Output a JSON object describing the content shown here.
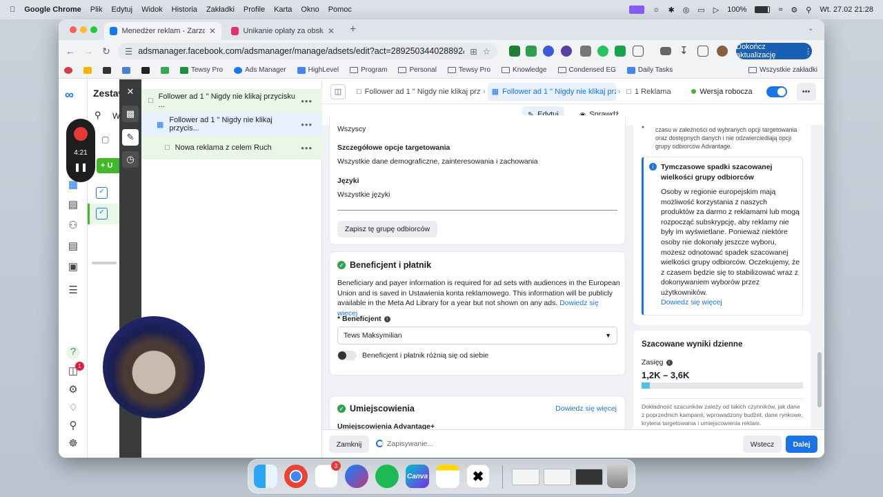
{
  "macbar": {
    "app": "Google Chrome",
    "menus": [
      "Plik",
      "Edytuj",
      "Widok",
      "Historia",
      "Zakładki",
      "Profile",
      "Karta",
      "Okno",
      "Pomoc"
    ],
    "battery": "100%",
    "datetime": "Wt. 27.02  21:28"
  },
  "browser": {
    "tabs": [
      {
        "title": "Menedżer reklam - Zarządza",
        "active": true,
        "favicon_color": "#1877f2"
      },
      {
        "title": "Unikanie opłaty za obsługę r",
        "active": false,
        "favicon_color": "#e1306c"
      }
    ],
    "url": "adsmanager.facebook.com/adsmanager/manage/adsets/edit?act=289250344028892&busines...",
    "update_label": "Dokończ aktualizację",
    "bookmarks": [
      "Tewsy Pro",
      "Ads Manager",
      "HighLevel",
      "Program",
      "Personal",
      "Tewsy Pro",
      "Knowledge",
      "Condensed EG",
      "Daily Tasks"
    ],
    "all_bookmarks": "Wszystkie zakładki"
  },
  "rail": {
    "title_partial": "Zestaw",
    "search_partial": "W",
    "notification_count": "1",
    "create_partial": "U"
  },
  "recorder": {
    "time": "4:21"
  },
  "tree": {
    "items": [
      {
        "label": "Follower ad 1 \" Nigdy nie klikaj przycisku ...",
        "level": 0
      },
      {
        "label": "Follower ad 1 \" Nigdy nie klikaj przycis...",
        "level": 1
      },
      {
        "label": "Nowa reklama z celem Ruch",
        "level": 2
      }
    ]
  },
  "breadcrumbs": {
    "campaign": "Follower ad 1 \" Nigdy nie klikaj przyc",
    "adset": "Follower ad 1 \" Nigdy nie klikaj przyc",
    "ad": "1 Reklama",
    "status": "Wersja robocza"
  },
  "modes": {
    "edit": "Edytuj",
    "review": "Sprawdź"
  },
  "audience": {
    "top_value": "Wszyscy",
    "detailed_label": "Szczegółowe opcje targetowania",
    "detailed_value": "Wszystkie dane demograficzne, zainteresowania i zachowania",
    "languages_label": "Języki",
    "languages_value": "Wszystkie języki",
    "save_button": "Zapisz tę grupę odbiorców"
  },
  "beneficiary": {
    "title": "Beneficjent i płatnik",
    "description": "Beneficiary and payer information is required for ad sets with audiences in the European Union and is saved in Ustawienia konta reklamowego. This information will be publicly available in the Meta Ad Library for a year but not shown on any ads.",
    "learn_more": "Dowiedz się więcej",
    "field_label": "* Beneficjent",
    "field_value": "Tews Maksymilian",
    "toggle_label": "Beneficjent i płatnik różnią się od siebie"
  },
  "placements": {
    "title": "Umiejscowienia",
    "learn_more": "Dowiedz się więcej",
    "sub_partial": "Umiejscowienia Advantage+"
  },
  "bottom": {
    "close": "Zamknij",
    "saving": "Zapisywanie...",
    "back": "Wstecz",
    "next": "Dalej"
  },
  "sidebar": {
    "top_note": "czasu w zależności od wybranych opcji targetowania oraz dostępnych danych i nie odzwierciedlają opcji grupy odbiorców Advantage.",
    "alert_title": "Tymczasowe spadki szacowanej wielkości grupy odbiorców",
    "alert_body": "Osoby w regionie europejskim mają możliwość korzystania z naszych produktów za darmo z reklamami lub mogą rozpocząć subskrypcję, aby reklamy nie były im wyświetlane. Ponieważ niektóre osoby nie dokonały jeszcze wyboru, możesz odnotować spadek szacowanej wielkości grupy odbiorców. Oczekujemy, że z czasem będzie się to stabilizować wraz z dokonywaniem wyborów przez użytkowników.",
    "alert_link": "Dowiedz się więcej",
    "results_title": "Szacowane wyniki dzienne",
    "reach_label": "Zasięg",
    "reach_value": "1,2K – 3,6K",
    "reach_fill": 0.05,
    "accuracy_note": "Dokładność szacunków zależy od takich czynników, jak dane z poprzednich kampanii, wprowadzony budżet, dane rynkowe, kryteria targetowania i umiejscowienia reklam."
  },
  "dock": {
    "apps": [
      "finder-icon",
      "chrome-icon",
      "slack-icon",
      "messenger-icon",
      "spotify-icon",
      "canva-icon",
      "notes-icon",
      "capcut-icon"
    ],
    "slack_badge": "3",
    "canva_label": "Canva"
  }
}
